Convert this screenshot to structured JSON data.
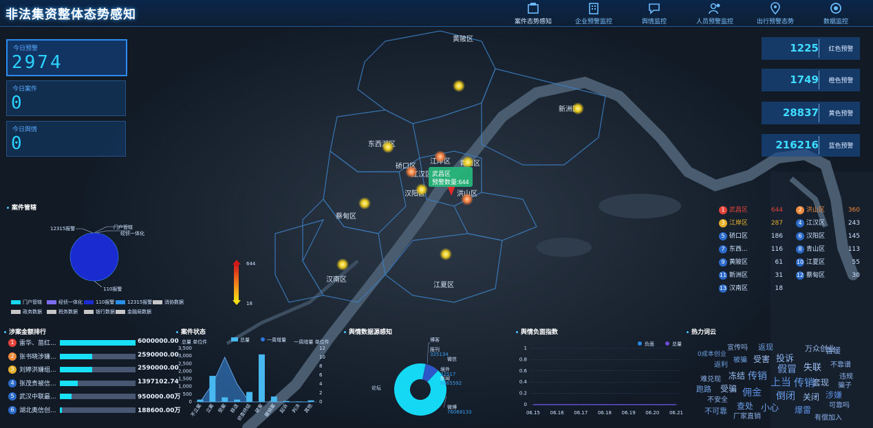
{
  "header": {
    "title": "非法集资整体态势感知"
  },
  "nav": [
    {
      "label": "案件态势感知",
      "icon": "case-icon"
    },
    {
      "label": "企业预警监控",
      "icon": "enterprise-icon"
    },
    {
      "label": "舆情监控",
      "icon": "opinion-icon"
    },
    {
      "label": "人员预警监控",
      "icon": "person-icon"
    },
    {
      "label": "出行预警态势",
      "icon": "travel-icon"
    },
    {
      "label": "数据监控",
      "icon": "data-icon"
    }
  ],
  "kpis": [
    {
      "label": "今日预警",
      "value": "2974"
    },
    {
      "label": "今日案件",
      "value": "0"
    },
    {
      "label": "今日舆情",
      "value": "0"
    }
  ],
  "warnings": [
    {
      "value": "1225",
      "label": "红色预警"
    },
    {
      "value": "1749",
      "label": "橙色预警"
    },
    {
      "value": "28837",
      "label": "黄色预警"
    },
    {
      "value": "216216",
      "label": "蓝色预警"
    }
  ],
  "map": {
    "districts": [
      "黄陂区",
      "新洲区",
      "东西湖区",
      "江岸区",
      "江汉区",
      "硚口区",
      "汉阳区",
      "武昌区",
      "洪山区",
      "青山区",
      "蔡甸区",
      "汉南区",
      "江夏区"
    ],
    "tooltip_title": "武昌区",
    "tooltip_text": "预警数量:644",
    "legend_max": "644",
    "legend_min": "18"
  },
  "district_rank": [
    {
      "rank": "1",
      "name": "武昌区",
      "value": "644",
      "color": "#e5433a"
    },
    {
      "rank": "2",
      "name": "洪山区",
      "value": "360",
      "color": "#f08a3c"
    },
    {
      "rank": "3",
      "name": "江岸区",
      "value": "287",
      "color": "#e7b02a"
    },
    {
      "rank": "4",
      "name": "江汉区",
      "value": "243",
      "color": "#2c6bc9"
    },
    {
      "rank": "5",
      "name": "硚口区",
      "value": "186",
      "color": "#2c6bc9"
    },
    {
      "rank": "6",
      "name": "汉阳区",
      "value": "145",
      "color": "#2c6bc9"
    },
    {
      "rank": "7",
      "name": "东西...",
      "value": "116",
      "color": "#2c6bc9"
    },
    {
      "rank": "8",
      "name": "青山区",
      "value": "113",
      "color": "#2c6bc9"
    },
    {
      "rank": "9",
      "name": "黄陂区",
      "value": "61",
      "color": "#2c6bc9"
    },
    {
      "rank": "10",
      "name": "江夏区",
      "value": "55",
      "color": "#2c6bc9"
    },
    {
      "rank": "11",
      "name": "新洲区",
      "value": "31",
      "color": "#2c6bc9"
    },
    {
      "rank": "12",
      "name": "蔡甸区",
      "value": "30",
      "color": "#2c6bc9"
    },
    {
      "rank": "13",
      "name": "汉南区",
      "value": "18",
      "color": "#2c6bc9"
    }
  ],
  "case_clues": {
    "title": "案件管辖",
    "pie_labels": [
      "12315报警",
      "门户管辖",
      "经侦一体化",
      "110报警"
    ],
    "legend_row1": [
      "门户管辖",
      "经侦一体化",
      "110报警",
      "12315报警",
      "消协数据"
    ],
    "legend_row2": [
      "政务数据",
      "税务数据",
      "银行数据",
      "金融局数据"
    ],
    "legend_colors": [
      "#18d8f0",
      "#7b6cf0",
      "#1a2bd0",
      "#2a8fe8",
      "#c6c6c6",
      "#c6c6c6",
      "#c6c6c6",
      "#c6c6c6",
      "#c6c6c6"
    ]
  },
  "amount_rank": {
    "title": "涉案金额排行",
    "items": [
      {
        "rank": "1",
        "name": "雷华、苗红...",
        "amount": "6000000.00",
        "value": 6000000,
        "color": "#e5433a"
      },
      {
        "rank": "2",
        "name": "张书晓涉嫌...",
        "amount": "2590000.00",
        "value": 2590000,
        "color": "#f08a3c"
      },
      {
        "rank": "3",
        "name": "刘婷洪嫌组...",
        "amount": "2590000.00",
        "value": 2590000,
        "color": "#e7b02a"
      },
      {
        "rank": "4",
        "name": "张茂贵被信...",
        "amount": "1397102.74",
        "value": 1397102.74,
        "color": "#2c6bc9"
      },
      {
        "rank": "5",
        "name": "武汉中联最...",
        "amount": "950000.00万",
        "value": 950000,
        "color": "#2c6bc9"
      },
      {
        "rank": "6",
        "name": "湖北奥信创...",
        "amount": "188600.00万",
        "value": 188600,
        "color": "#2c6bc9"
      }
    ]
  },
  "case_status": {
    "title": "案件状态",
    "legend": [
      "总量",
      "一周增量"
    ],
    "left_axis_title": "总量 单位件",
    "right_axis_title": "一周增量 单位件"
  },
  "opinion_source": {
    "title": "舆情数据源感知",
    "labels": [
      {
        "name": "论坛",
        "value": ""
      },
      {
        "name": "博客",
        "value": ""
      },
      {
        "name": "报刊",
        "value": "325134"
      },
      {
        "name": "微信",
        "value": ""
      },
      {
        "name": "境外",
        "value": "32517"
      },
      {
        "name": "新闻",
        "value": "6865592"
      },
      {
        "name": "微博",
        "value": "76068133"
      }
    ]
  },
  "negative_index": {
    "title": "舆情负面指数",
    "legend": [
      "负面",
      "总量"
    ],
    "y_ticks": [
      "1",
      "0.8",
      "0.6",
      "0.4",
      "0.2",
      "0"
    ],
    "x_ticks": [
      "06.15",
      "06.16",
      "06.17",
      "06.18",
      "06.19",
      "06.20",
      "06.21"
    ]
  },
  "hot_words": {
    "title": "热力词云",
    "words": [
      "宣传吗",
      "返现",
      "暂缓",
      "0成本创业",
      "万众创业",
      "被骗",
      "受害",
      "投诉",
      "返利",
      "假冒",
      "失联",
      "不靠谱",
      "冻结",
      "传销",
      "上当",
      "传销",
      "难兑现",
      "套现",
      "违规",
      "跑路",
      "受骗",
      "佣金",
      "倒闭",
      "关闭",
      "骗子",
      "不安全",
      "查处",
      "涉嫌",
      "不可靠",
      "厂家直销",
      "小心",
      "爆雷",
      "有偿加入",
      "可靠吗"
    ]
  },
  "chart_data": [
    {
      "type": "pie",
      "title": "案件管辖",
      "categories": [
        "门户管辖",
        "经侦一体化",
        "110报警",
        "12315报警",
        "消协数据",
        "政务数据",
        "税务数据",
        "银行数据",
        "金融局数据"
      ],
      "values": [
        0.3,
        0.3,
        99.1,
        0.3,
        0,
        0,
        0,
        0,
        0
      ]
    },
    {
      "type": "bar",
      "title": "案件状态",
      "categories": [
        "不立案",
        "立案",
        "受案",
        "移送",
        "侦查终结",
        "破案",
        "撤销案",
        "起诉",
        "判决",
        "其他"
      ],
      "series": [
        {
          "name": "总量",
          "type": "bar",
          "values": [
            150,
            1700,
            300,
            150,
            650,
            3100,
            350,
            60,
            30,
            100
          ]
        },
        {
          "name": "一周增量",
          "type": "area",
          "values": [
            0,
            4,
            10,
            4,
            0,
            0,
            0,
            0,
            0,
            0
          ]
        }
      ],
      "ylim": [
        0,
        3500
      ],
      "y2lim": [
        0,
        12
      ]
    },
    {
      "type": "pie",
      "title": "舆情数据源感知",
      "categories": [
        "论坛",
        "博客",
        "报刊",
        "微信",
        "境外",
        "新闻",
        "微博"
      ],
      "values": [
        0.05,
        0.05,
        0.4,
        0.05,
        0.04,
        8.2,
        91.2
      ]
    },
    {
      "type": "line",
      "title": "舆情负面指数",
      "x": [
        "06.15",
        "06.16",
        "06.17",
        "06.18",
        "06.19",
        "06.20",
        "06.21"
      ],
      "series": [
        {
          "name": "负面",
          "values": [
            0,
            0,
            0,
            0,
            0,
            0,
            0
          ]
        },
        {
          "name": "总量",
          "values": [
            0,
            0,
            0,
            0,
            0,
            0,
            0
          ]
        }
      ],
      "ylim": [
        0,
        1
      ]
    }
  ]
}
